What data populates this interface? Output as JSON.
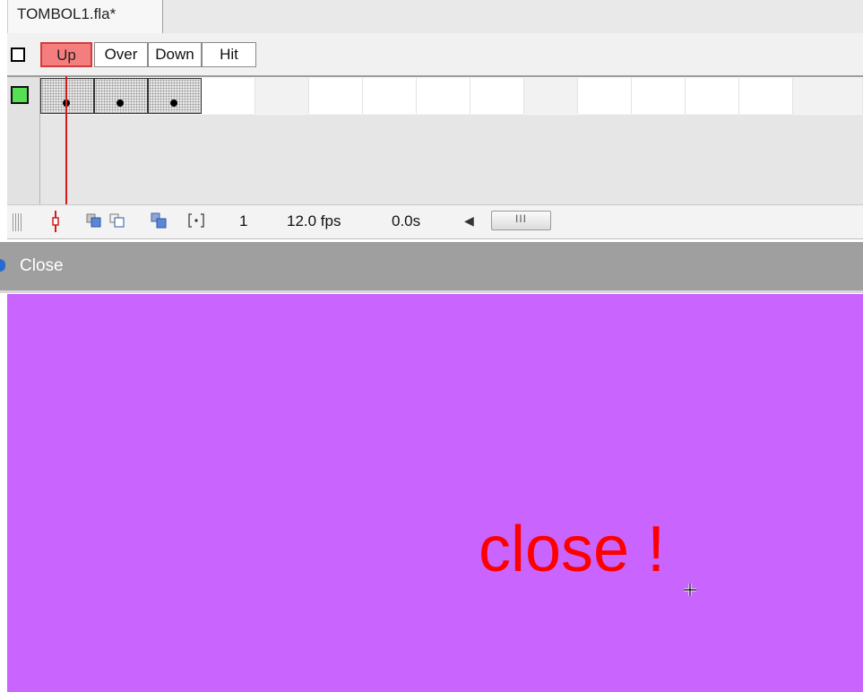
{
  "document": {
    "tab_title": "TOMBOL1.fla*"
  },
  "timeline": {
    "frame_labels": [
      "Up",
      "Over",
      "Down",
      "Hit"
    ],
    "current_frame": "1",
    "frame_rate": "12.0 fps",
    "elapsed_time": "0.0s",
    "scrollbar_thumb": "III"
  },
  "edit_bar": {
    "symbol_name": "Close"
  },
  "stage": {
    "text": "close !",
    "background_color": "#c964ff",
    "text_color": "#ff0000"
  },
  "colors": {
    "selected_frame_label": "#f47d7d",
    "playhead": "#d41b1b",
    "layer_color": "#55e055"
  },
  "icons": [
    "outline-toggle-icon",
    "layer-color-icon",
    "playhead-icon",
    "center-frame-icon",
    "onion-skin-icon",
    "onion-skin-outlines-icon",
    "edit-multiple-frames-icon",
    "modify-onion-markers-icon",
    "scroll-left-arrow-icon",
    "crosshair-cursor-icon"
  ]
}
